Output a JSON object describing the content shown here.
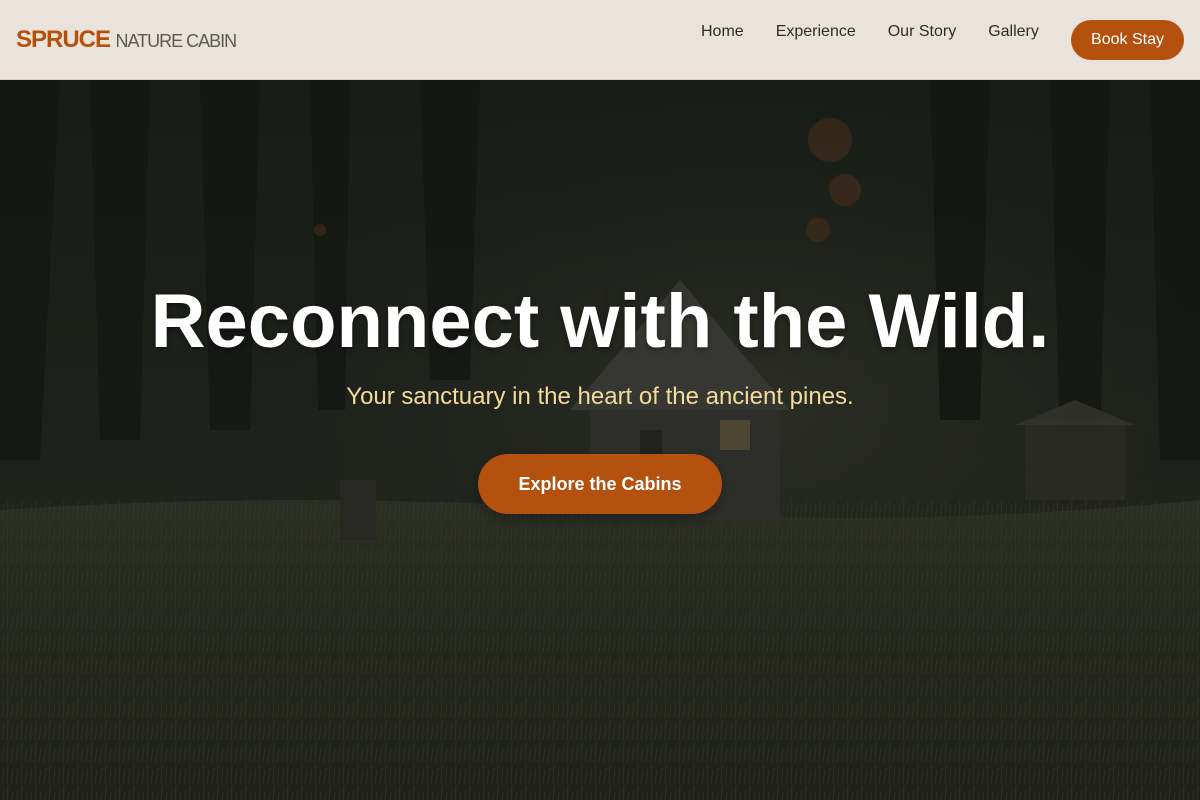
{
  "header": {
    "logo_main": "SPRUCE",
    "logo_sub": "NATURE CABIN",
    "nav": [
      "Home",
      "Experience",
      "Our Story",
      "Gallery"
    ],
    "book_label": "Book Stay"
  },
  "hero": {
    "title": "Reconnect with the Wild.",
    "subtitle": "Your sanctuary in the heart of the ancient pines.",
    "cta_label": "Explore the Cabins"
  },
  "colors": {
    "accent": "#b5510f",
    "header_bg": "#eae3db",
    "subtitle": "#f2dc9a"
  }
}
